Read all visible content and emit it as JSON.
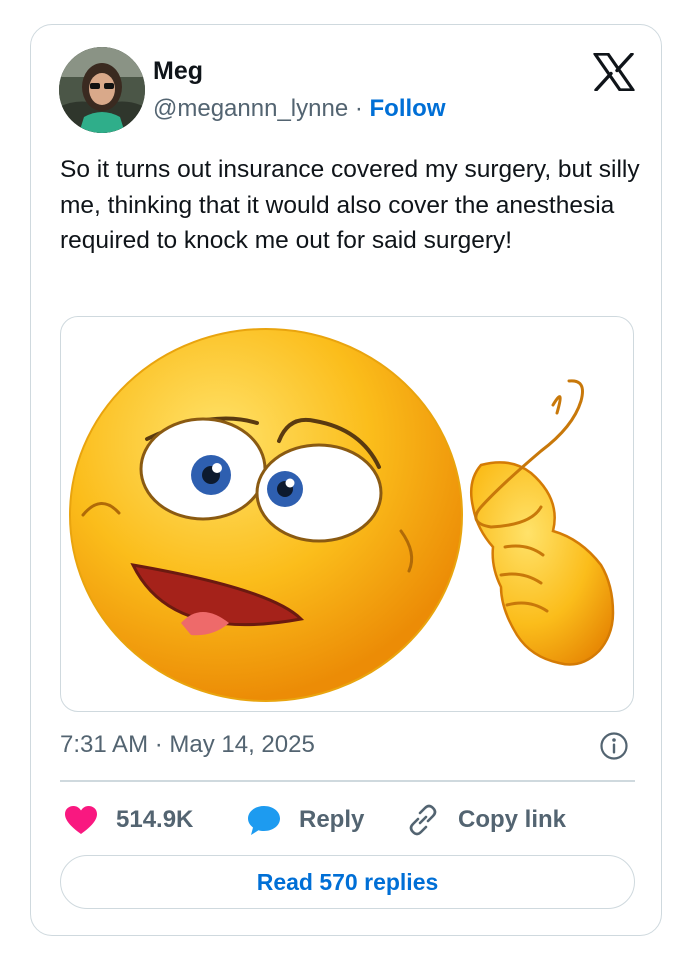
{
  "user": {
    "name": "Meg",
    "handle": "@megannn_lynne",
    "separator": " · ",
    "follow_label": "Follow"
  },
  "tweet": {
    "text": "So it turns out insurance covered my surgery, but silly me, thinking that it would also cover the anesthesia required to knock me out for said surgery!",
    "image_icon": "emoji-crazy-face",
    "timestamp": "7:31 AM · May 14, 2025"
  },
  "actions": {
    "likes_count": "514.9K",
    "reply_label": "Reply",
    "copy_label": "Copy link",
    "read_replies_label": "Read 570 replies"
  },
  "colors": {
    "accent": "#006fd6",
    "heart": "#f91880",
    "muted": "#536471",
    "border": "#cfd9de",
    "reply_bubble": "#1d9bf0"
  }
}
